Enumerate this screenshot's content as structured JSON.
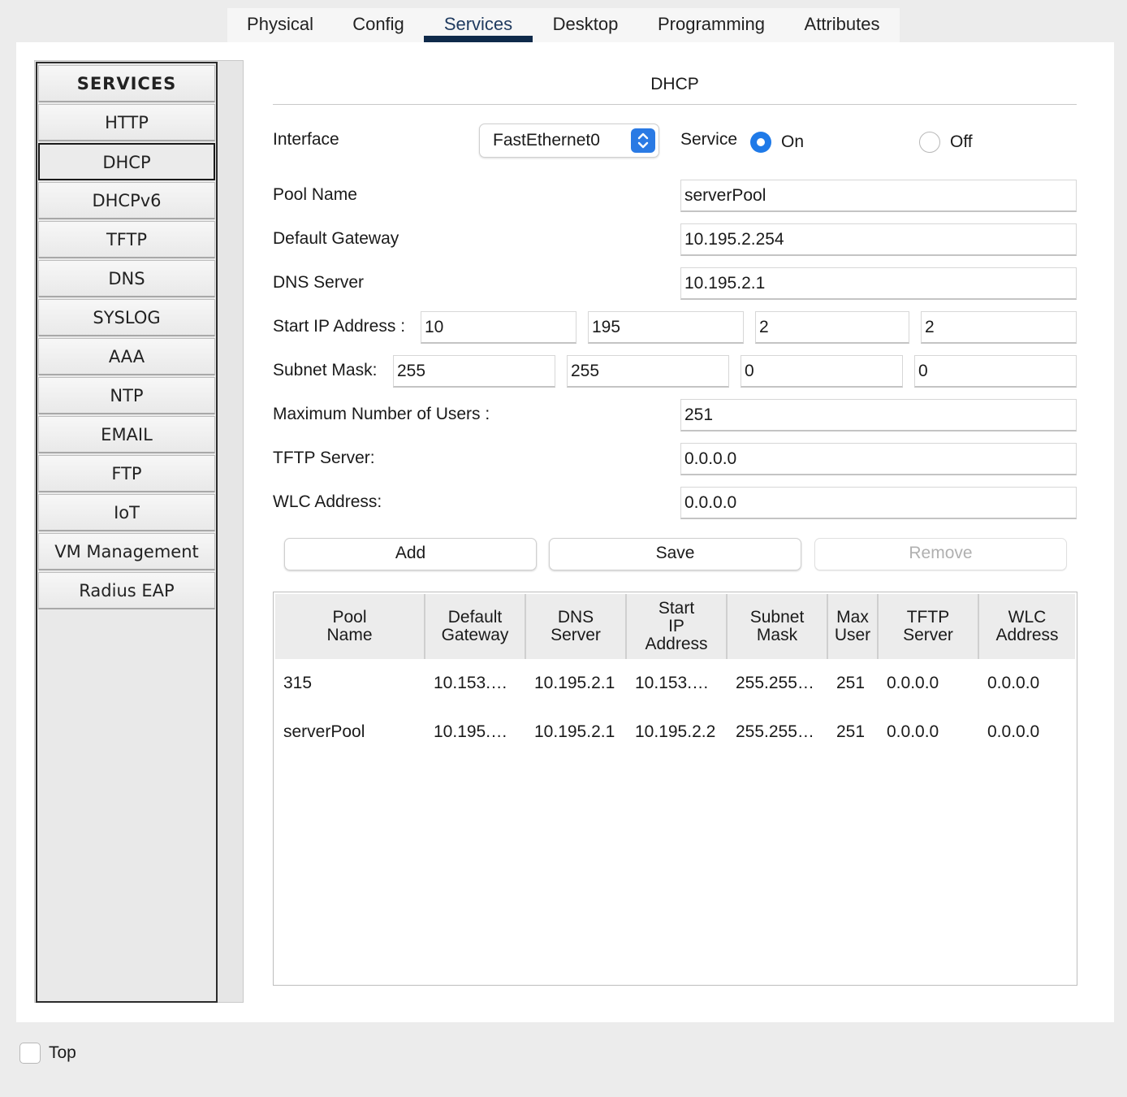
{
  "tabs": [
    {
      "label": "Physical",
      "active": false
    },
    {
      "label": "Config",
      "active": false
    },
    {
      "label": "Services",
      "active": true
    },
    {
      "label": "Desktop",
      "active": false
    },
    {
      "label": "Programming",
      "active": false
    },
    {
      "label": "Attributes",
      "active": false
    }
  ],
  "sidebar": {
    "header": "SERVICES",
    "items": [
      "HTTP",
      "DHCP",
      "DHCPv6",
      "TFTP",
      "DNS",
      "SYSLOG",
      "AAA",
      "NTP",
      "EMAIL",
      "FTP",
      "IoT",
      "VM Management",
      "Radius EAP"
    ],
    "active": "DHCP"
  },
  "dhcp": {
    "title": "DHCP",
    "interface_label": "Interface",
    "interface_value": "FastEthernet0",
    "service_label": "Service",
    "service_on_label": "On",
    "service_off_label": "Off",
    "service_state": "On",
    "pool_name_label": "Pool Name",
    "pool_name": "serverPool",
    "gateway_label": "Default Gateway",
    "gateway": "10.195.2.254",
    "dns_label": "DNS Server",
    "dns": "10.195.2.1",
    "start_ip_label": "Start IP Address :",
    "start_ip": [
      "10",
      "195",
      "2",
      "2"
    ],
    "subnet_label": "Subnet Mask:",
    "subnet": [
      "255",
      "255",
      "0",
      "0"
    ],
    "max_users_label": "Maximum Number of Users :",
    "max_users": "251",
    "tftp_label": "TFTP Server:",
    "tftp": "0.0.0.0",
    "wlc_label": "WLC Address:",
    "wlc": "0.0.0.0"
  },
  "buttons": {
    "add": "Add",
    "save": "Save",
    "remove": "Remove"
  },
  "table": {
    "headers": [
      "Pool\nName",
      "Default\nGateway",
      "DNS\nServer",
      "Start\nIP\nAddress",
      "Subnet\nMask",
      "Max\nUser",
      "TFTP\nServer",
      "WLC\nAddress"
    ],
    "rows": [
      [
        "315",
        "10.153.…",
        "10.195.2.1",
        "10.153.…",
        "255.255…",
        "251",
        "0.0.0.0",
        "0.0.0.0"
      ],
      [
        "serverPool",
        "10.195.…",
        "10.195.2.1",
        "10.195.2.2",
        "255.255…",
        "251",
        "0.0.0.0",
        "0.0.0.0"
      ]
    ]
  },
  "footer": {
    "top_checkbox_label": "Top",
    "top_checked": false
  },
  "colors": {
    "accent": "#1f7ae8",
    "active_tab_underline": "#0f2a4a"
  }
}
